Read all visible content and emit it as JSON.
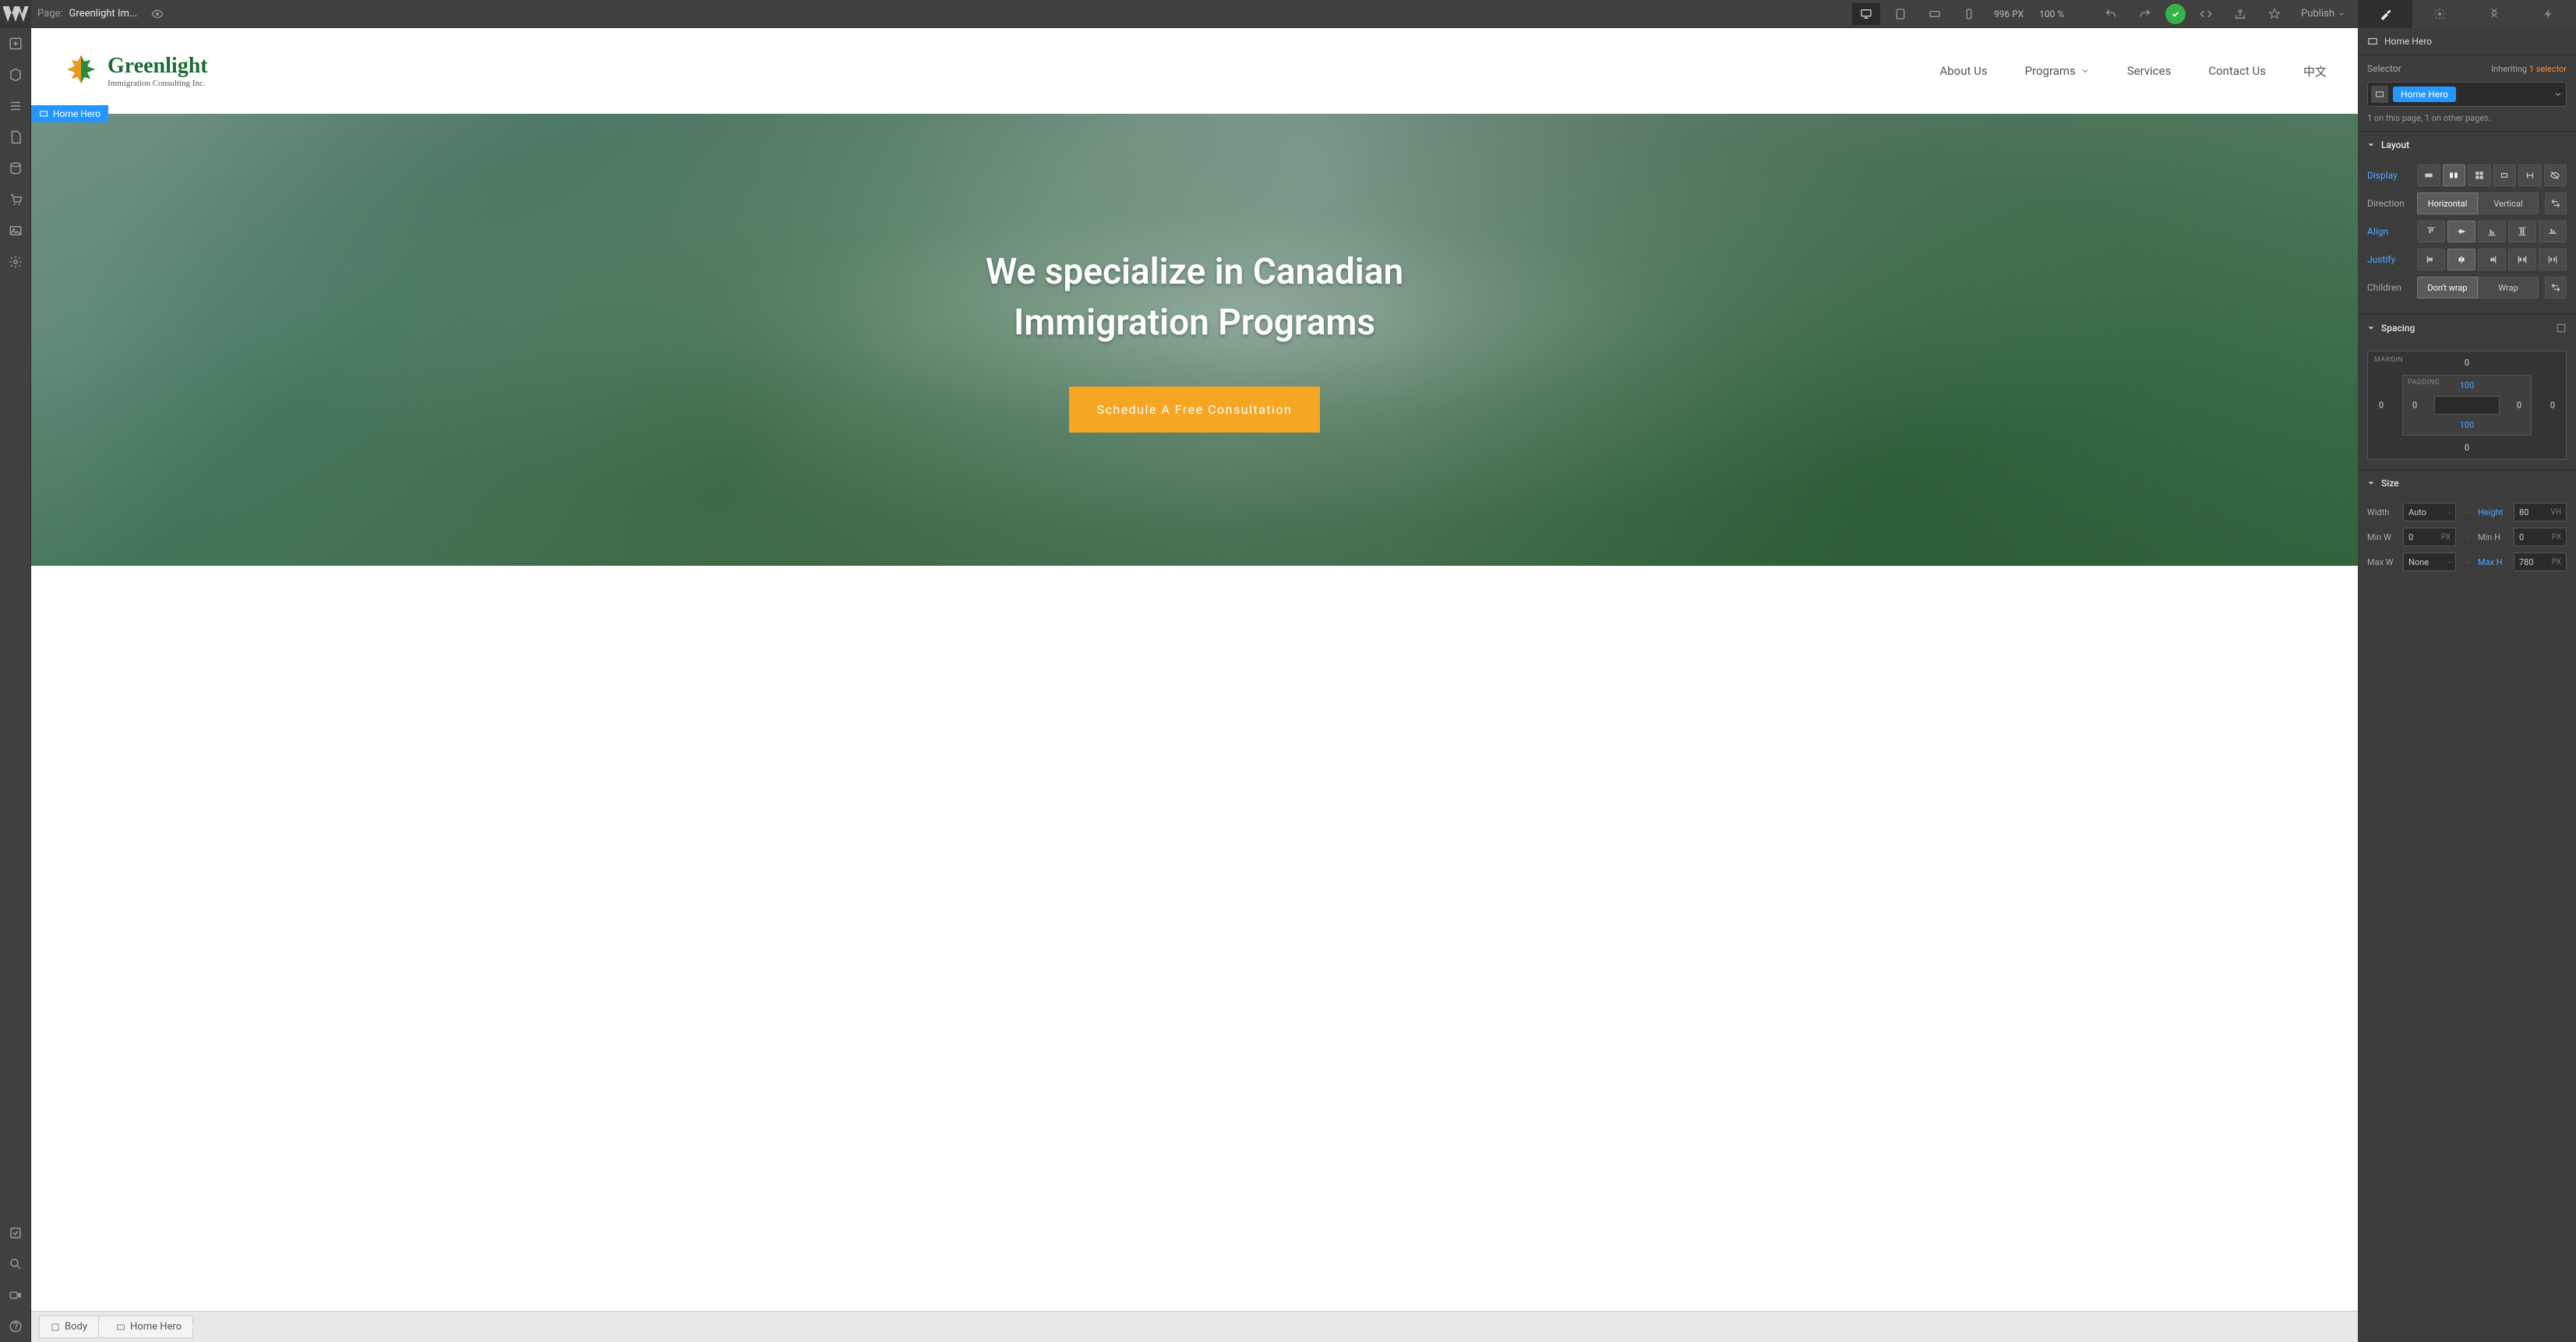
{
  "topbar": {
    "page_label": "Page:",
    "page_name": "Greenlight Im...",
    "viewport_px": "996",
    "viewport_px_unit": "PX",
    "zoom": "100",
    "zoom_unit": "%",
    "publish": "Publish"
  },
  "canvas": {
    "site": {
      "logo_title": "Greenlight",
      "logo_sub": "Immigration Consulting Inc.",
      "nav": [
        {
          "label": "About Us"
        },
        {
          "label": "Programs",
          "dropdown": true
        },
        {
          "label": "Services"
        },
        {
          "label": "Contact Us"
        },
        {
          "label": "中文"
        }
      ]
    },
    "hero": {
      "tag": "Home Hero",
      "title_line1": "We specialize in Canadian",
      "title_line2": "Immigration Programs",
      "cta": "Schedule A Free Consultation"
    }
  },
  "breadcrumb": {
    "items": [
      "Body",
      "Home Hero"
    ]
  },
  "right": {
    "element_label": "Home Hero",
    "selector": {
      "label": "Selector",
      "inheriting": "Inheriting",
      "inherit_count": "1 selector",
      "chip": "Home Hero",
      "note_this": "1 on this page,",
      "note_other": "1 on other pages."
    },
    "layout": {
      "title": "Layout",
      "display": "Display",
      "direction": "Direction",
      "direction_h": "Horizontal",
      "direction_v": "Vertical",
      "align": "Align",
      "justify": "Justify",
      "children": "Children",
      "children_nowrap": "Don't wrap",
      "children_wrap": "Wrap"
    },
    "spacing": {
      "title": "Spacing",
      "margin_label": "MARGIN",
      "padding_label": "PADDING",
      "margin": {
        "t": "0",
        "r": "0",
        "b": "0",
        "l": "0"
      },
      "padding": {
        "t": "100",
        "r": "0",
        "b": "100",
        "l": "0"
      }
    },
    "size": {
      "title": "Size",
      "width": "Width",
      "width_val": "Auto",
      "height": "Height",
      "height_val": "80",
      "height_unit": "VH",
      "min_w": "Min W",
      "min_w_val": "0",
      "min_w_unit": "PX",
      "min_h": "Min H",
      "min_h_val": "0",
      "min_h_unit": "PX",
      "max_w": "Max W",
      "max_w_val": "None",
      "max_h": "Max H",
      "max_h_val": "780",
      "max_h_unit": "PX"
    }
  }
}
